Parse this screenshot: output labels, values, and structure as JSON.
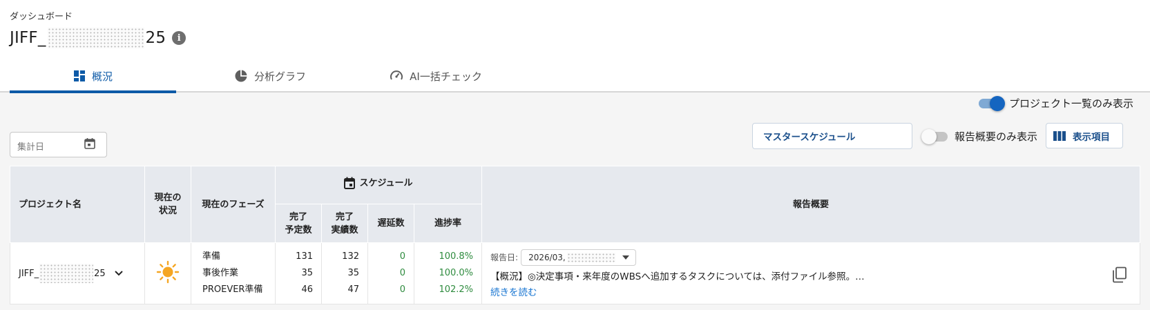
{
  "header": {
    "breadcrumb": "ダッシュボード",
    "title_prefix": "JIFF_",
    "title_suffix": "25",
    "info_icon": "info-icon"
  },
  "tabs": [
    {
      "label": "概況",
      "icon": "dashboard-icon",
      "active": true
    },
    {
      "label": "分析グラフ",
      "icon": "pie-chart-icon",
      "active": false
    },
    {
      "label": "AI一括チェック",
      "icon": "speedometer-icon",
      "active": false
    }
  ],
  "toolbar": {
    "project_only_label": "プロジェクト一覧のみ表示",
    "project_only_on": true,
    "date_placeholder": "集計日",
    "master_schedule_label": "マスタースケジュール",
    "report_only_label": "報告概要のみ表示",
    "report_only_on": false,
    "columns_label": "表示項目"
  },
  "table": {
    "headers": {
      "project": "プロジェクト名",
      "status_line1": "現在の",
      "status_line2": "状況",
      "phase": "現在のフェーズ",
      "schedule": "スケジュール",
      "planned_line1": "完了",
      "planned_line2": "予定数",
      "actual_line1": "完了",
      "actual_line2": "実績数",
      "delay": "遅延数",
      "progress": "進捗率",
      "report": "報告概要"
    },
    "row": {
      "project_prefix": "JIFF_",
      "project_suffix": "25",
      "status_icon": "sun-icon",
      "phases": [
        {
          "name": "準備",
          "planned": "131",
          "actual": "132",
          "delay": "0",
          "progress": "100.8%"
        },
        {
          "name": "事後作業",
          "planned": "35",
          "actual": "35",
          "delay": "0",
          "progress": "100.0%"
        },
        {
          "name": "PROEVER準備",
          "planned": "46",
          "actual": "47",
          "delay": "0",
          "progress": "102.2%"
        }
      ],
      "report_date_label": "報告日:",
      "report_date_value": "2026/03,",
      "report_text": "【概況】◎決定事項・来年度のWBSへ追加するタスクについては、添付ファイル参照。…",
      "read_more": "続きを読む"
    }
  },
  "colors": {
    "accent": "#0d5aa7",
    "header_bg": "#e6e9ee",
    "progress_green": "#2e8b3e",
    "sun": "#f5a623",
    "link": "#1976d2"
  }
}
